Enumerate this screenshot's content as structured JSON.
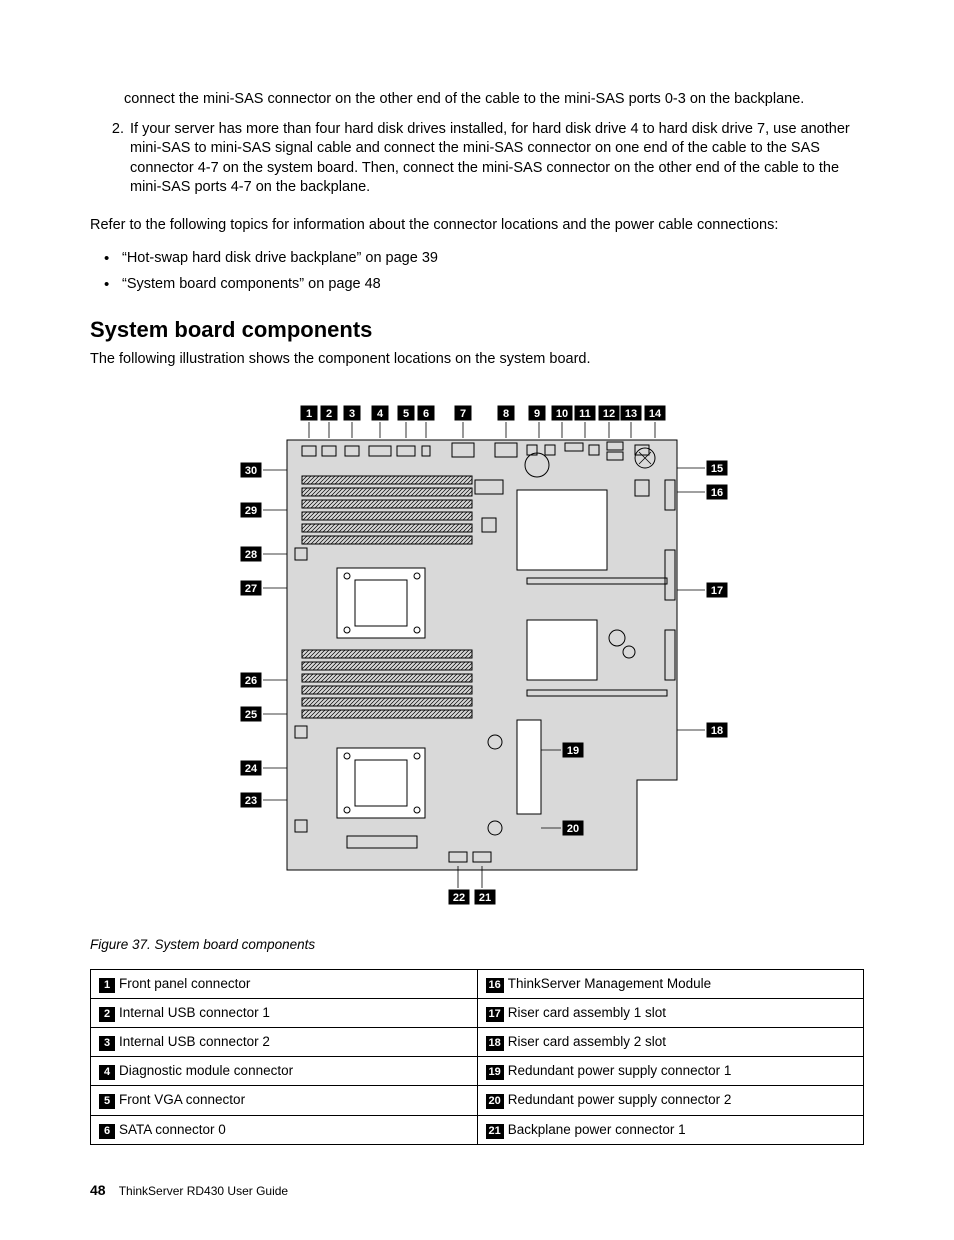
{
  "intro_list": {
    "item1_cont": "connect the mini-SAS connector on the other end of the cable to the mini-SAS ports 0-3 on the backplane.",
    "item2": "If your server has more than four hard disk drives installed, for hard disk drive 4 to hard disk drive 7, use another mini-SAS to mini-SAS signal cable and connect the mini-SAS connector on one end of the cable to the SAS connector 4-7 on the system board. Then, connect the mini-SAS connector on the other end of the cable to the mini-SAS ports 4-7 on the backplane."
  },
  "refer_para": "Refer to the following topics for information about the connector locations and the power cable connections:",
  "refer_bullets": [
    "“Hot-swap hard disk drive backplane” on page 39",
    "“System board components” on page 48"
  ],
  "section_title": "System board components",
  "section_para": "The following illustration shows the component locations on the system board.",
  "figure_caption": "Figure 37.  System board components",
  "callouts_top": [
    "1",
    "2",
    "3",
    "4",
    "5",
    "6",
    "7",
    "8",
    "9",
    "10",
    "11",
    "12",
    "13",
    "14"
  ],
  "callouts_right": [
    "15",
    "16",
    "17",
    "18"
  ],
  "callouts_left": [
    "30",
    "29",
    "28",
    "27",
    "26",
    "25",
    "24",
    "23"
  ],
  "callouts_bottom_mid": [
    "19",
    "20"
  ],
  "callouts_bottom": [
    "22",
    "21"
  ],
  "legend_rows": [
    {
      "ln": "1",
      "lt": "Front panel connector",
      "rn": "16",
      "rt": "ThinkServer Management Module"
    },
    {
      "ln": "2",
      "lt": "Internal USB connector 1",
      "rn": "17",
      "rt": "Riser card assembly 1 slot"
    },
    {
      "ln": "3",
      "lt": "Internal USB connector 2",
      "rn": "18",
      "rt": "Riser card assembly 2 slot"
    },
    {
      "ln": "4",
      "lt": "Diagnostic module connector",
      "rn": "19",
      "rt": "Redundant power supply connector 1"
    },
    {
      "ln": "5",
      "lt": "Front VGA connector",
      "rn": "20",
      "rt": "Redundant power supply connector 2"
    },
    {
      "ln": "6",
      "lt": "SATA connector 0",
      "rn": "21",
      "rt": "Backplane power connector 1"
    }
  ],
  "footer": {
    "page": "48",
    "book": "ThinkServer RD430 User Guide"
  }
}
